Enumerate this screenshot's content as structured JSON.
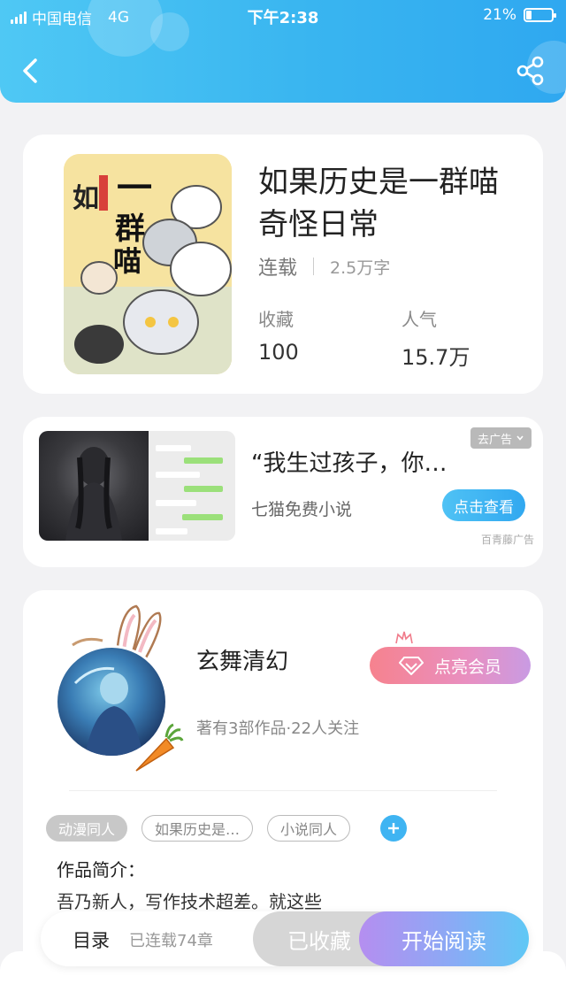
{
  "status_bar": {
    "carrier": "中国电信",
    "network": "4G",
    "time": "下午2:38",
    "battery": "21%"
  },
  "header": {
    "back_icon": "chevron-left-icon",
    "share_icon": "share-icon"
  },
  "book": {
    "title": "如果历史是一群喵奇怪日常",
    "status": "连载",
    "word_count": "2.5万字",
    "favorites_label": "收藏",
    "favorites_value": "100",
    "popularity_label": "人气",
    "popularity_value": "15.7万"
  },
  "ad": {
    "title": "“我生过孩子，你…",
    "source": "七猫免费小说",
    "button": "点击查看",
    "remove_label": "去广告",
    "provider": "百青藤广告"
  },
  "author": {
    "name": "玄舞清幻",
    "info": "著有3部作品·22人关注",
    "vip_button": "点亮会员",
    "tags": [
      "动漫同人",
      "如果历史是…",
      "小说同人"
    ],
    "intro_label": "作品简介：",
    "intro_text": "吾乃新人，写作技术超差。就这些"
  },
  "bottom_bar": {
    "toc_label": "目录",
    "chapters": "已连载74章",
    "collected_button": "已收藏",
    "read_button": "开始阅读"
  },
  "colors": {
    "header_blue": "#39b5f0",
    "accent_blue": "#3fb4f2",
    "vip_pink": "#f6828e",
    "read_purple": "#b58ef0"
  }
}
